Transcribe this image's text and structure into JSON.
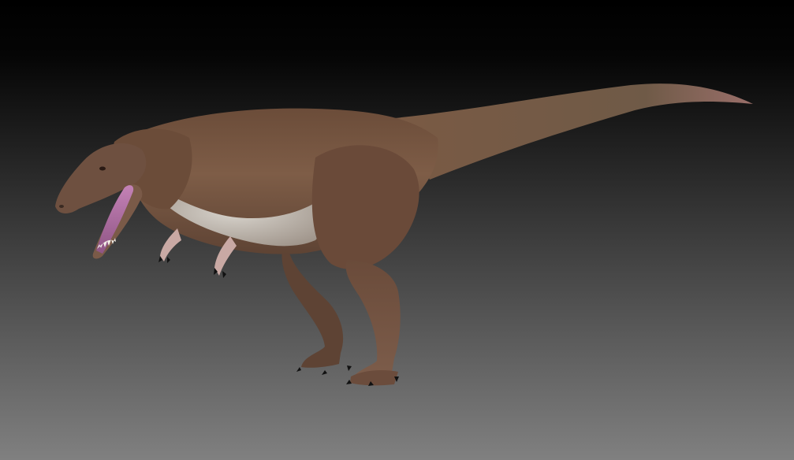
{
  "scene": {
    "subject": "tyrannosaur-model",
    "colors": {
      "background_top": "#000000",
      "background_bottom": "#808080",
      "body_brown": "#7a5a44",
      "body_dark": "#5a3f30",
      "belly_light": "#c9c4bd",
      "mouth_pink": "#b06fa2",
      "teeth": "#f2eee6",
      "claws": "#111111"
    }
  }
}
